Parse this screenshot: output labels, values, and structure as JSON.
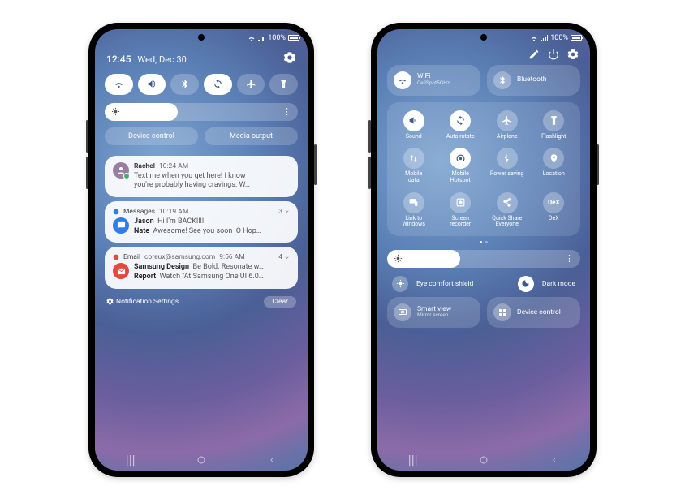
{
  "status": {
    "battery": "100%",
    "signal": true
  },
  "panel1": {
    "time": "12:45",
    "date": "Wed, Dec 30",
    "toggles": [
      {
        "id": "wifi",
        "on": true
      },
      {
        "id": "sound",
        "on": true
      },
      {
        "id": "bluetooth",
        "on": false
      },
      {
        "id": "autorotate",
        "on": true
      },
      {
        "id": "airplane",
        "on": false
      },
      {
        "id": "flashlight",
        "on": false
      }
    ],
    "brightness_pct": 38,
    "chips": {
      "device_control": "Device control",
      "media_output": "Media output"
    },
    "notifications": [
      {
        "app": "Rachel",
        "time": "10:24 AM",
        "count": "",
        "icon_color": "#9c7ca3",
        "icon_badge": "#3db36a",
        "title": "",
        "lines": [
          "Text me when you get here! I know",
          "you're probably having cravings. W…"
        ]
      },
      {
        "app": "Messages",
        "time": "10:19 AM",
        "count": "3",
        "icon_color": "#2f7de6",
        "title": "Jason",
        "body1": "Hi I'm BACK!!!!!",
        "title2": "Nate",
        "body2": "Awesome! See you soon :O Hop…"
      },
      {
        "app": "Email",
        "sub": "coreux@samsung.com",
        "time": "9:56 AM",
        "count": "4",
        "icon_color": "#e24a3d",
        "title": "Samsung Design",
        "body1": "Be Bold. Resonate w…",
        "title2": "Report",
        "body2": "Watch \"At Samsung One UI 6.0…"
      }
    ],
    "footer": {
      "settings": "Notification Settings",
      "clear": "Clear"
    }
  },
  "panel2": {
    "top_tiles": [
      {
        "id": "wifi",
        "title": "WiFi",
        "sub": "CellSpot5GHz",
        "on": true
      },
      {
        "id": "bluetooth",
        "title": "Bluetooth",
        "sub": "",
        "on": false
      }
    ],
    "grid": [
      {
        "id": "sound",
        "label": "Sound",
        "on": true
      },
      {
        "id": "autorotate",
        "label": "Auto rotate",
        "on": true
      },
      {
        "id": "airplane",
        "label": "Airplane",
        "on": false
      },
      {
        "id": "flashlight",
        "label": "Flashlight",
        "on": false
      },
      {
        "id": "mobiledata",
        "label": "Mobile\ndata",
        "on": false
      },
      {
        "id": "hotspot",
        "label": "Mobile\nHotspot",
        "on": true
      },
      {
        "id": "powersaving",
        "label": "Power saving",
        "on": false
      },
      {
        "id": "location",
        "label": "Location",
        "on": false
      },
      {
        "id": "linkwindows",
        "label": "Link to\nWindows",
        "on": false
      },
      {
        "id": "screenrec",
        "label": "Screen\nrecorder",
        "on": false
      },
      {
        "id": "quickshare",
        "label": "Quick Share\nEveryone",
        "on": false
      },
      {
        "id": "dex",
        "label": "DeX",
        "on": false
      }
    ],
    "brightness_pct": 38,
    "modes": [
      {
        "id": "eyecomfort",
        "label": "Eye comfort shield",
        "on": false
      },
      {
        "id": "darkmode",
        "label": "Dark mode",
        "on": true
      }
    ],
    "bottom_tiles": [
      {
        "id": "smartview",
        "title": "Smart view",
        "sub": "Mirror screen"
      },
      {
        "id": "devicecontrol",
        "title": "Device control",
        "sub": ""
      }
    ]
  }
}
